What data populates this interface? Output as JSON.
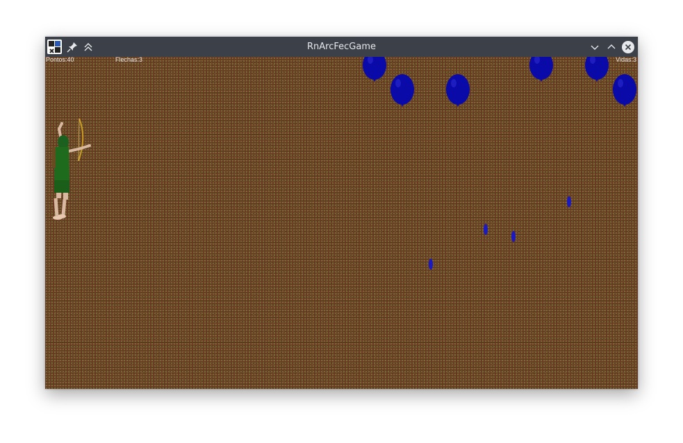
{
  "window": {
    "title": "RnArcFecGame"
  },
  "hud": {
    "score": "Pontos:40",
    "arrows": "Flechas:3",
    "lives": "Vidas:3"
  },
  "titlebar_icons": [
    "app-icon",
    "pin-icon",
    "keep-above-icon",
    "minimize-icon",
    "maximize-icon",
    "close-icon"
  ],
  "colors": {
    "balloon": "#0a0aa8",
    "ground": "#5e3521",
    "archer_clothes": "#1e6b1e",
    "titlebar": "#3c4048"
  }
}
